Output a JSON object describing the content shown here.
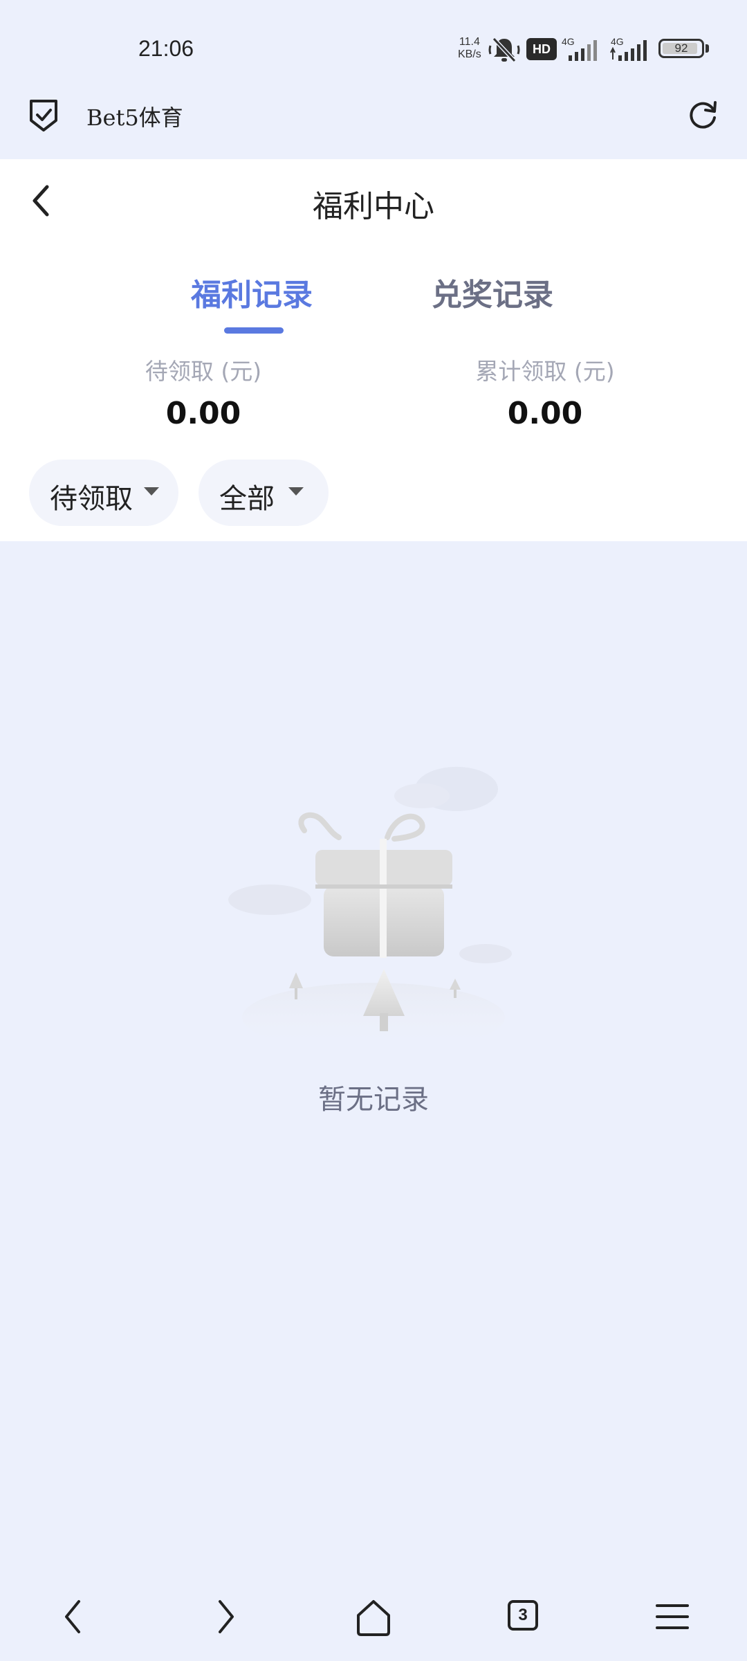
{
  "status_bar": {
    "time": "21:06",
    "net_speed_value": "11.4",
    "net_speed_unit": "KB/s",
    "hd_label": "HD",
    "sim1_label": "4G",
    "sim2_label": "4G",
    "battery_level": "92",
    "battery_fraction": 0.92
  },
  "browser": {
    "site_name": "Bet5体育",
    "shield_icon": "shield-check-icon",
    "reload_icon": "reload-icon"
  },
  "page": {
    "title": "福利中心",
    "back_icon": "chevron-left-icon"
  },
  "tabs": [
    {
      "label": "福利记录",
      "active": true
    },
    {
      "label": "兑奖记录",
      "active": false
    }
  ],
  "stats": {
    "pending_label": "待领取 (元)",
    "pending_value": "0.00",
    "total_label": "累计领取 (元)",
    "total_value": "0.00"
  },
  "filters": {
    "status_label": "待领取",
    "type_label": "全部"
  },
  "empty_state": {
    "icon": "gift-box-icon",
    "text": "暂无记录"
  },
  "bottom_nav": {
    "back_icon": "chevron-left-icon",
    "forward_icon": "chevron-right-icon",
    "home_icon": "home-icon",
    "tab_count": "3",
    "menu_icon": "menu-icon"
  },
  "colors": {
    "accent": "#5a79e0",
    "background": "#ecf0fc",
    "inactive_tab": "#6b6f85"
  }
}
